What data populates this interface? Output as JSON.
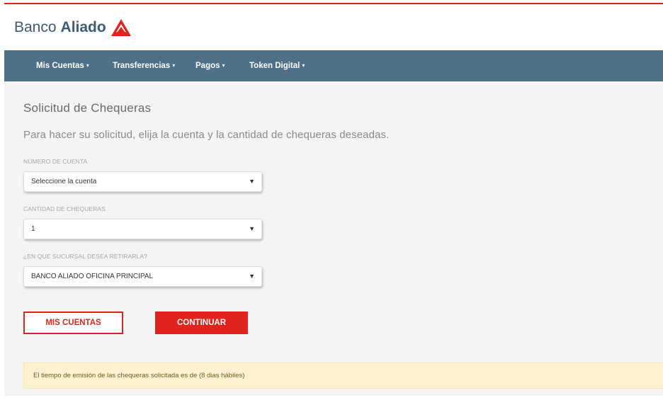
{
  "brand": {
    "name_light": "Banco",
    "name_bold": "Aliado",
    "accent_color": "#e0231c",
    "text_color": "#3b5b7a"
  },
  "nav": {
    "items": [
      {
        "label": "Mis Cuentas"
      },
      {
        "label": "Transferencias"
      },
      {
        "label": "Pagos"
      },
      {
        "label": "Token Digital"
      }
    ],
    "caret": "▾",
    "background_color": "#4f7089"
  },
  "page": {
    "title": "Solicitud de Chequeras",
    "subtitle": "Para hacer su solicitud, elija la cuenta y la cantidad de chequeras deseadas."
  },
  "form": {
    "account": {
      "label": "NÚMERO DE CUENTA",
      "value": "Seleccione la cuenta"
    },
    "quantity": {
      "label": "CANTIDAD DE CHEQUERAS",
      "value": "1"
    },
    "branch": {
      "label": "¿EN QUE SUCURSAL DESEA RETIRARLA?",
      "value": "BANCO ALIADO OFICINA PRINCIPAL"
    },
    "select_arrow": "▼"
  },
  "actions": {
    "back_label": "MIS CUENTAS",
    "continue_label": "CONTINUAR"
  },
  "notice": {
    "text": "El tiempo de emisión de las chequeras solicitada es de (8 dias hábiles)"
  }
}
